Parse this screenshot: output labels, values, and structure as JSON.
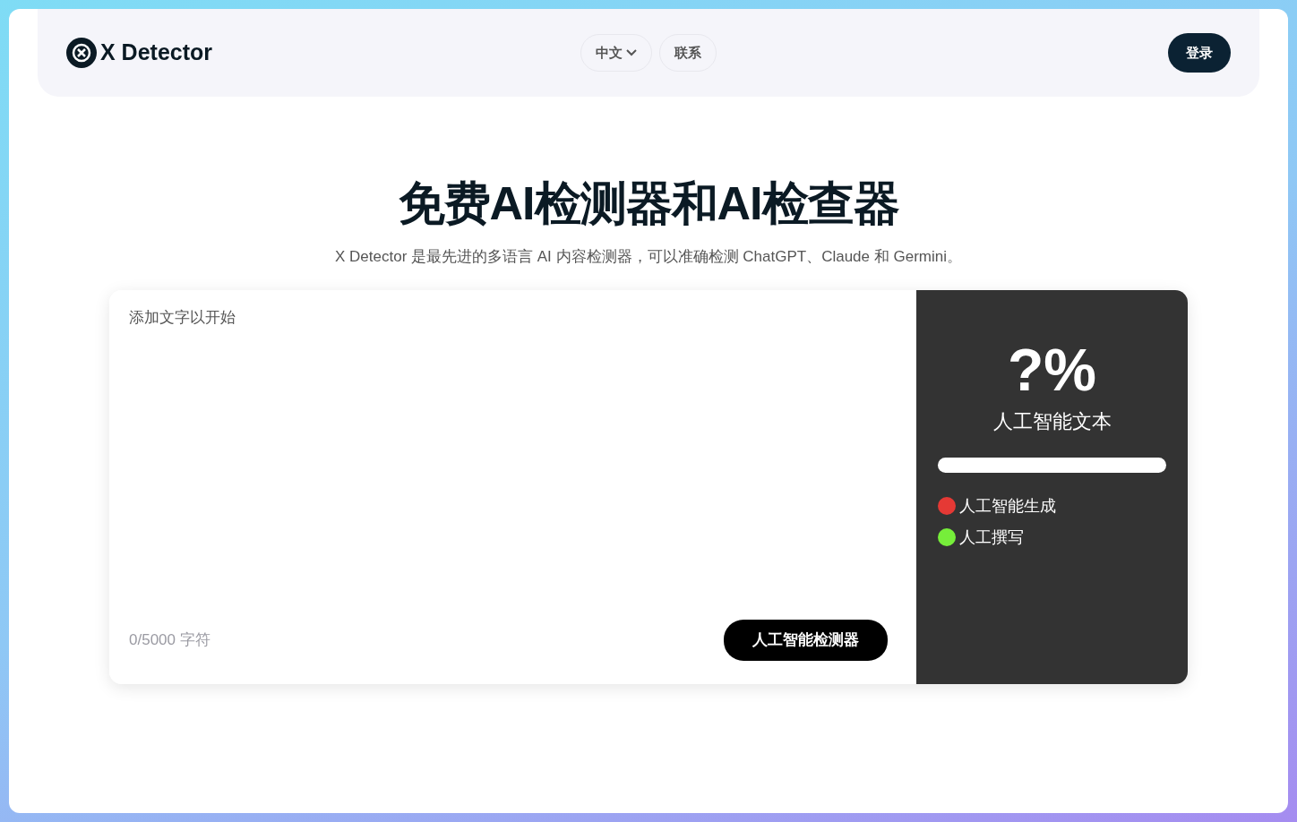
{
  "header": {
    "logo": "X Detector",
    "nav": [
      {
        "label": "中文",
        "kind": "dropdown"
      },
      {
        "label": "联系",
        "kind": "link"
      }
    ],
    "login": "登录"
  },
  "hero": {
    "title": "免费AI检测器和AI检查器",
    "subtitle": "X Detector 是最先进的多语言 AI 内容检测器，可以准确检测 ChatGPT、Claude 和 Germini。"
  },
  "editor": {
    "placeholder": "添加文字以开始",
    "counter": "0/5000 字符",
    "button": "人工智能检测器"
  },
  "result": {
    "percent": "?%",
    "label": "人工智能文本",
    "legend": [
      {
        "label": "人工智能生成",
        "color": "#e53935"
      },
      {
        "label": "人工撰写",
        "color": "#76ee3a"
      }
    ]
  }
}
